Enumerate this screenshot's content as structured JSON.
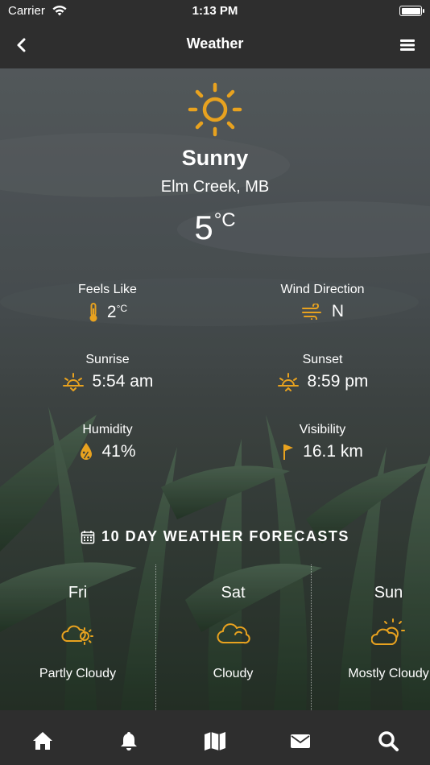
{
  "status_bar": {
    "carrier": "Carrier",
    "time": "1:13 PM"
  },
  "nav": {
    "title": "Weather",
    "back_icon": "chevron-left-icon",
    "menu_icon": "hamburger-menu-icon"
  },
  "current": {
    "condition": "Sunny",
    "location": "Elm Creek, MB",
    "temperature": "5",
    "temperature_unit": "°C",
    "icon": "sun-icon",
    "accent_color": "#E8A21F"
  },
  "stats": {
    "feels_like": {
      "label": "Feels Like",
      "value": "2",
      "unit": "°C",
      "icon": "thermometer-icon"
    },
    "wind_direction": {
      "label": "Wind Direction",
      "value": "N",
      "icon": "wind-icon"
    },
    "sunrise": {
      "label": "Sunrise",
      "value": "5:54 am",
      "icon": "sunrise-icon"
    },
    "sunset": {
      "label": "Sunset",
      "value": "8:59 pm",
      "icon": "sunset-icon"
    },
    "humidity": {
      "label": "Humidity",
      "value": "41%",
      "icon": "humidity-drop-icon"
    },
    "visibility": {
      "label": "Visibility",
      "value": "16.1 km",
      "icon": "flag-icon"
    }
  },
  "forecast": {
    "title": "10 DAY WEATHER FORECASTS",
    "icon": "calendar-icon",
    "days": [
      {
        "name": "Fri",
        "description": "Partly Cloudy",
        "icon": "partly-cloudy-icon"
      },
      {
        "name": "Sat",
        "description": "Cloudy",
        "icon": "cloudy-icon"
      },
      {
        "name": "Sun",
        "description": "Mostly Cloudy",
        "icon": "mostly-cloudy-icon"
      }
    ]
  },
  "tab_bar": {
    "items": [
      {
        "name": "home",
        "icon": "home-icon"
      },
      {
        "name": "alerts",
        "icon": "bell-icon"
      },
      {
        "name": "map",
        "icon": "map-icon"
      },
      {
        "name": "messages",
        "icon": "envelope-icon"
      },
      {
        "name": "search",
        "icon": "search-icon"
      }
    ]
  }
}
